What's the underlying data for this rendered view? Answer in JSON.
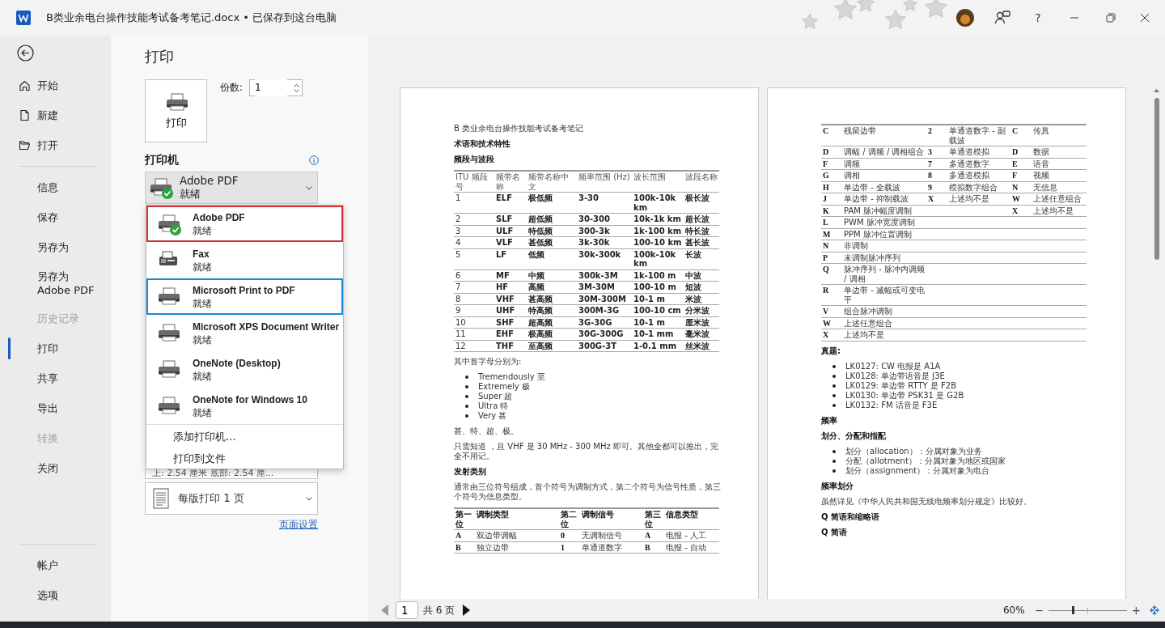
{
  "window": {
    "title": "B类业余电台操作技能考试备考笔记.docx • 已保存到这台电脑",
    "help": "?"
  },
  "nav": {
    "top": [
      {
        "label": "开始",
        "selected": false,
        "disabled": false
      },
      {
        "label": "新建",
        "selected": false,
        "disabled": false
      },
      {
        "label": "打开",
        "selected": false,
        "disabled": false
      }
    ],
    "items": [
      {
        "label": "信息",
        "selected": false,
        "disabled": false
      },
      {
        "label": "保存",
        "selected": false,
        "disabled": false
      },
      {
        "label": "另存为",
        "selected": false,
        "disabled": false
      },
      {
        "label": "另存为 Adobe PDF",
        "selected": false,
        "disabled": false
      },
      {
        "label": "历史记录",
        "selected": false,
        "disabled": true
      },
      {
        "label": "打印",
        "selected": true,
        "disabled": false
      },
      {
        "label": "共享",
        "selected": false,
        "disabled": false
      },
      {
        "label": "导出",
        "selected": false,
        "disabled": false
      },
      {
        "label": "转换",
        "selected": false,
        "disabled": true
      },
      {
        "label": "关闭",
        "selected": false,
        "disabled": false
      }
    ],
    "bottom": [
      {
        "label": "帐户",
        "selected": false,
        "disabled": false
      },
      {
        "label": "选项",
        "selected": false,
        "disabled": false
      }
    ]
  },
  "print": {
    "heading": "打印",
    "print_button": "打印",
    "copies": {
      "label": "份数:",
      "value": "1"
    },
    "printer": {
      "heading": "打印机",
      "name": "Adobe PDF",
      "status": "就绪",
      "kind": "printer",
      "default": true
    },
    "printer_list": [
      {
        "name": "Adobe PDF",
        "status": "就绪",
        "kind": "printer",
        "default": true,
        "selected": true,
        "focused": false
      },
      {
        "name": "Fax",
        "status": "就绪",
        "kind": "fax",
        "default": false,
        "selected": false,
        "focused": false
      },
      {
        "name": "Microsoft Print to PDF",
        "status": "就绪",
        "kind": "printer",
        "default": false,
        "selected": false,
        "focused": true
      },
      {
        "name": "Microsoft XPS Document Writer",
        "status": "就绪",
        "kind": "printer",
        "default": false,
        "selected": false,
        "focused": false
      },
      {
        "name": "OneNote (Desktop)",
        "status": "就绪",
        "kind": "printer",
        "default": false,
        "selected": false,
        "focused": false
      },
      {
        "name": "OneNote for Windows 10",
        "status": "就绪",
        "kind": "printer",
        "default": false,
        "selected": false,
        "focused": false
      }
    ],
    "list_actions": [
      "添加打印机...",
      "打印到文件"
    ],
    "settings": [
      {
        "kind": "margins",
        "text": "上: 2.54 厘米 底部: 2.54 厘..."
      },
      {
        "kind": "pages-per-sheet",
        "text": "每版打印 1 页"
      }
    ],
    "page_setup_link": "页面设置"
  },
  "preview": {
    "pages": [
      {
        "blocks": [
          {
            "kind": "doc-title",
            "text": "B 类业余电台操作技能考试备考笔记"
          },
          {
            "kind": "heading",
            "text": "术语和技术特性"
          },
          {
            "kind": "heading",
            "text": "频段与波段"
          },
          {
            "kind": "band-table",
            "columns": [
              "ITU 频段号",
              "频带名称",
              "频带名称中文",
              "频率范围 (Hz)",
              "波长范围",
              "波段名称"
            ],
            "rows": [
              [
                "1",
                "ELF",
                "极低频",
                "3-30",
                "100k-10k km",
                "极长波"
              ],
              [
                "2",
                "SLF",
                "超低频",
                "30-300",
                "10k-1k km",
                "超长波"
              ],
              [
                "3",
                "ULF",
                "特低频",
                "300-3k",
                "1k-100 km",
                "特长波"
              ],
              [
                "4",
                "VLF",
                "甚低频",
                "3k-30k",
                "100-10 km",
                "甚长波"
              ],
              [
                "5",
                "LF",
                "低频",
                "30k-300k",
                "100k-10k km",
                "长波"
              ],
              [
                "6",
                "MF",
                "中频",
                "300k-3M",
                "1k-100 m",
                "中波"
              ],
              [
                "7",
                "HF",
                "高频",
                "3M-30M",
                "100-10 m",
                "短波"
              ],
              [
                "8",
                "VHF",
                "甚高频",
                "30M-300M",
                "10-1 m",
                "米波"
              ],
              [
                "9",
                "UHF",
                "特高频",
                "300M-3G",
                "100-10 cm",
                "分米波"
              ],
              [
                "10",
                "SHF",
                "超高频",
                "3G-30G",
                "10-1 m",
                "厘米波"
              ],
              [
                "11",
                "EHF",
                "极高频",
                "30G-300G",
                "10-1 mm",
                "毫米波"
              ],
              [
                "12",
                "THF",
                "至高频",
                "300G-3T",
                "1-0.1 mm",
                "丝米波"
              ]
            ]
          },
          {
            "kind": "para",
            "text": "其中首字母分别为:"
          },
          {
            "kind": "bullets",
            "items": [
              "Tremendously 至",
              "Extremely 极",
              "Super 超",
              "Ultra 特",
              "Very 甚"
            ]
          },
          {
            "kind": "para",
            "text": "甚、特、超、极。"
          },
          {
            "kind": "para",
            "text": "只需知道 ，且 VHF 是 30 MHz - 300 MHz 即可。其他全都可以推出，完全不用记。"
          },
          {
            "kind": "heading",
            "text": "发射类别"
          },
          {
            "kind": "para",
            "text": "通常由三位符号组成，首个符号为调制方式，第二个符号为信号性质，第三个符号为信息类型。"
          },
          {
            "kind": "emission-table",
            "columns": [
              "第一位",
              "调制类型",
              "第二位",
              "调制信号",
              "第三位",
              "信息类型"
            ],
            "rows": [
              {
                "position_1": "A",
                "modulation": "双边带调幅",
                "position_2": "0",
                "signal": "无调制信号",
                "position_3": "A",
                "information": "电报 - 人工"
              },
              {
                "position_1": "B",
                "modulation": "独立边带",
                "position_2": "1",
                "signal": "单通道数字",
                "position_3": "B",
                "information": "电报 - 自动"
              }
            ]
          }
        ]
      },
      {
        "blocks": [
          {
            "kind": "emission-table",
            "rows": [
              {
                "position_1": "C",
                "modulation": "残留边带",
                "position_2": "2",
                "signal": "单通道数字 - 副载波",
                "position_3": "C",
                "information": "传真"
              },
              {
                "position_1": "D",
                "modulation": "调幅 / 调频 / 调相组合",
                "position_2": "3",
                "signal": "单通道模拟",
                "position_3": "D",
                "information": "数据"
              },
              {
                "position_1": "F",
                "modulation": "调频",
                "position_2": "7",
                "signal": "多通道数字",
                "position_3": "E",
                "information": "语音"
              },
              {
                "position_1": "G",
                "modulation": "调相",
                "position_2": "8",
                "signal": "多通道模拟",
                "position_3": "F",
                "information": "视频"
              },
              {
                "position_1": "H",
                "modulation": "单边带 - 全载波",
                "position_2": "9",
                "signal": "模拟数字组合",
                "position_3": "N",
                "information": "无信息"
              },
              {
                "position_1": "J",
                "modulation": "单边带 - 抑制载波",
                "position_2": "X",
                "signal": "上述均不是",
                "position_3": "W",
                "information": "上述任意组合"
              },
              {
                "position_1": "K",
                "modulation": "PAM 脉冲幅度调制",
                "position_3": "X",
                "information": "上述均不是"
              },
              {
                "position_1": "L",
                "modulation": "PWM 脉冲宽度调制"
              },
              {
                "position_1": "M",
                "modulation": "PPM 脉冲位置调制"
              },
              {
                "position_1": "N",
                "modulation": "非调制"
              },
              {
                "position_1": "P",
                "modulation": "未调制脉冲序列"
              },
              {
                "position_1": "Q",
                "modulation": "脉冲序列 - 脉冲内调频 / 调相"
              },
              {
                "position_1": "R",
                "modulation": "单边带 - 减幅或可变电平"
              },
              {
                "position_1": "V",
                "modulation": "组合脉冲调制"
              },
              {
                "position_1": "W",
                "modulation": "上述任意组合"
              },
              {
                "position_1": "X",
                "modulation": "上述均不是"
              }
            ]
          },
          {
            "kind": "heading",
            "text": "真题:"
          },
          {
            "kind": "bullets",
            "items": [
              "LK0127: CW 电报是 A1A",
              "LK0128: 单边带语音是 J3E",
              "LK0129: 单边带 RTTY 是 F2B",
              "LK0130: 单边带 PSK31 是 G2B",
              "LK0132: FM 话音是 F3E"
            ]
          },
          {
            "kind": "heading",
            "text": "频率"
          },
          {
            "kind": "heading",
            "text": "划分、分配和指配"
          },
          {
            "kind": "bullets",
            "items": [
              "划分（allocation）：分属对象为业务",
              "分配（allotment）：分属对象为地区或国家",
              "划分（assignment）：分属对象为电台"
            ]
          },
          {
            "kind": "heading",
            "text": "频率划分"
          },
          {
            "kind": "para",
            "text": "虽然详见《中华人民共和国无线电频率划分规定》比较好。"
          },
          {
            "kind": "heading",
            "text": "Q 简语和缩略语"
          },
          {
            "kind": "heading",
            "text": "Q 简语"
          }
        ]
      }
    ],
    "navigation": {
      "page": "1",
      "total": "共 6 页"
    },
    "zoom": {
      "reading": "60%",
      "zoom_out": "−",
      "zoom_in": "+",
      "level": 0.31
    }
  }
}
